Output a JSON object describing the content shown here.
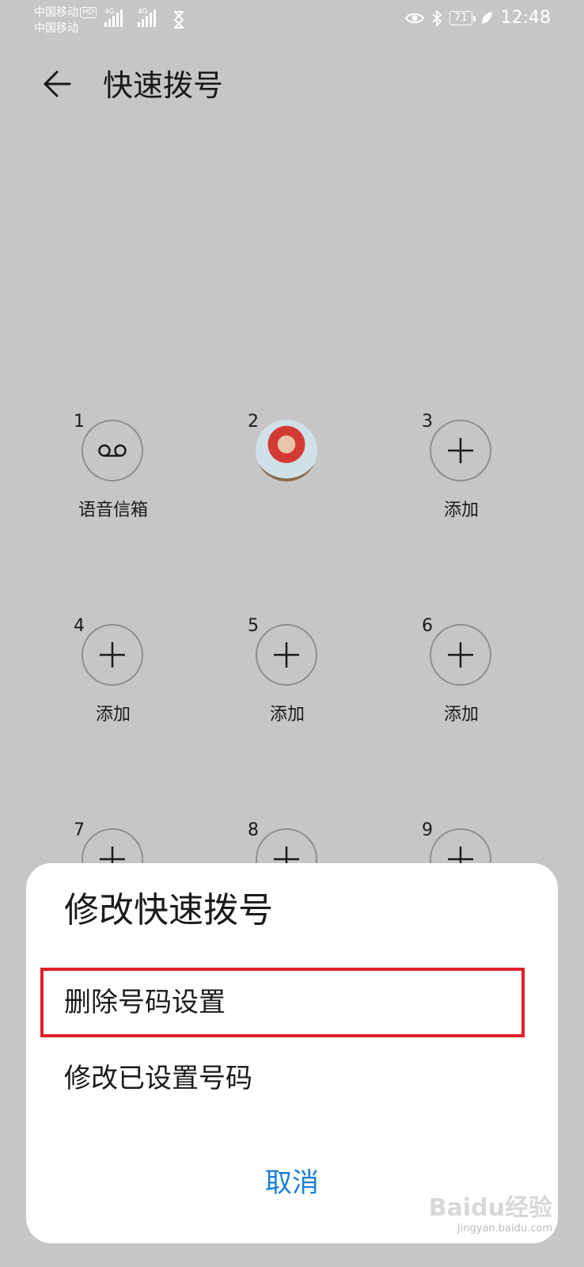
{
  "status_bar": {
    "carrier1": "中国移动",
    "carrier2": "中国移动",
    "hd": "HD",
    "net1": "4G",
    "net2": "4G",
    "battery": "71",
    "time": "12:48"
  },
  "header": {
    "title": "快速拨号"
  },
  "grid": {
    "items": [
      {
        "num": "1",
        "label": "语音信箱",
        "icon": "voicemail-icon"
      },
      {
        "num": "2",
        "label": "",
        "icon": "avatar"
      },
      {
        "num": "3",
        "label": "添加",
        "icon": "plus-icon"
      },
      {
        "num": "4",
        "label": "添加",
        "icon": "plus-icon"
      },
      {
        "num": "5",
        "label": "添加",
        "icon": "plus-icon"
      },
      {
        "num": "6",
        "label": "添加",
        "icon": "plus-icon"
      },
      {
        "num": "7",
        "label": "",
        "icon": "plus-icon"
      },
      {
        "num": "8",
        "label": "",
        "icon": "plus-icon"
      },
      {
        "num": "9",
        "label": "",
        "icon": "plus-icon"
      }
    ]
  },
  "dialog": {
    "title": "修改快速拨号",
    "option_delete": "删除号码设置",
    "option_modify": "修改已设置号码",
    "cancel": "取消"
  },
  "watermark": {
    "brand": "Baidu经验",
    "url": "jingyan.baidu.com"
  },
  "colors": {
    "background": "#c6c6c6",
    "accent": "#1a7fd4",
    "highlight": "#e0212b"
  }
}
